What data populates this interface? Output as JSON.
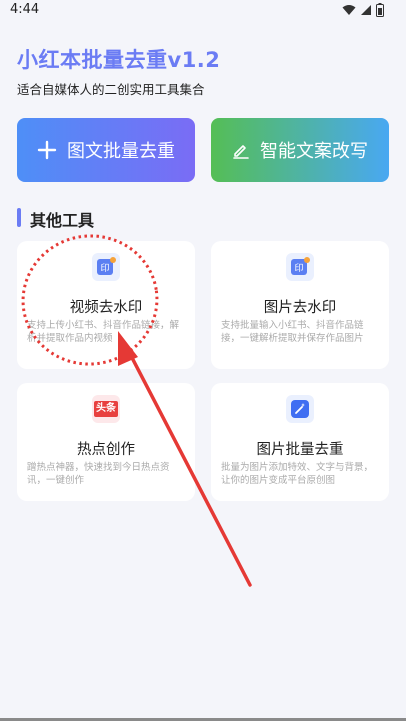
{
  "status_bar": {
    "time": "4:44",
    "icons": [
      "wifi-icon",
      "signal-icon",
      "battery-icon"
    ]
  },
  "header": {
    "title": "小红本批量去重v1.2",
    "subtitle": "适合自媒体人的二创实用工具集合"
  },
  "actions": {
    "batch_dedupe_label": "图文批量去重",
    "batch_dedupe_icon": "plus-icon",
    "smart_rewrite_label": "智能文案改写",
    "smart_rewrite_icon": "pencil-icon"
  },
  "section": {
    "title": "其他工具"
  },
  "tools": [
    {
      "title": "视频去水印",
      "desc": "支持上传小红书、抖音作品链接，解析并提取作品内视频",
      "icon": "seal-icon"
    },
    {
      "title": "图片去水印",
      "desc": "支持批量输入小红书、抖音作品链接，一键解析提取并保存作品图片",
      "icon": "seal-icon"
    },
    {
      "title": "热点创作",
      "desc": "蹭热点神器，快速找到今日热点资讯，一键创作",
      "icon": "toutiao-icon",
      "icon_text": "头条"
    },
    {
      "title": "图片批量去重",
      "desc": "批量为图片添加特效、文字与背景，让你的图片变成平台原创图",
      "icon": "magic-wand-icon"
    }
  ],
  "colors": {
    "accent": "#6b7cf4",
    "annotation": "#e53935"
  }
}
